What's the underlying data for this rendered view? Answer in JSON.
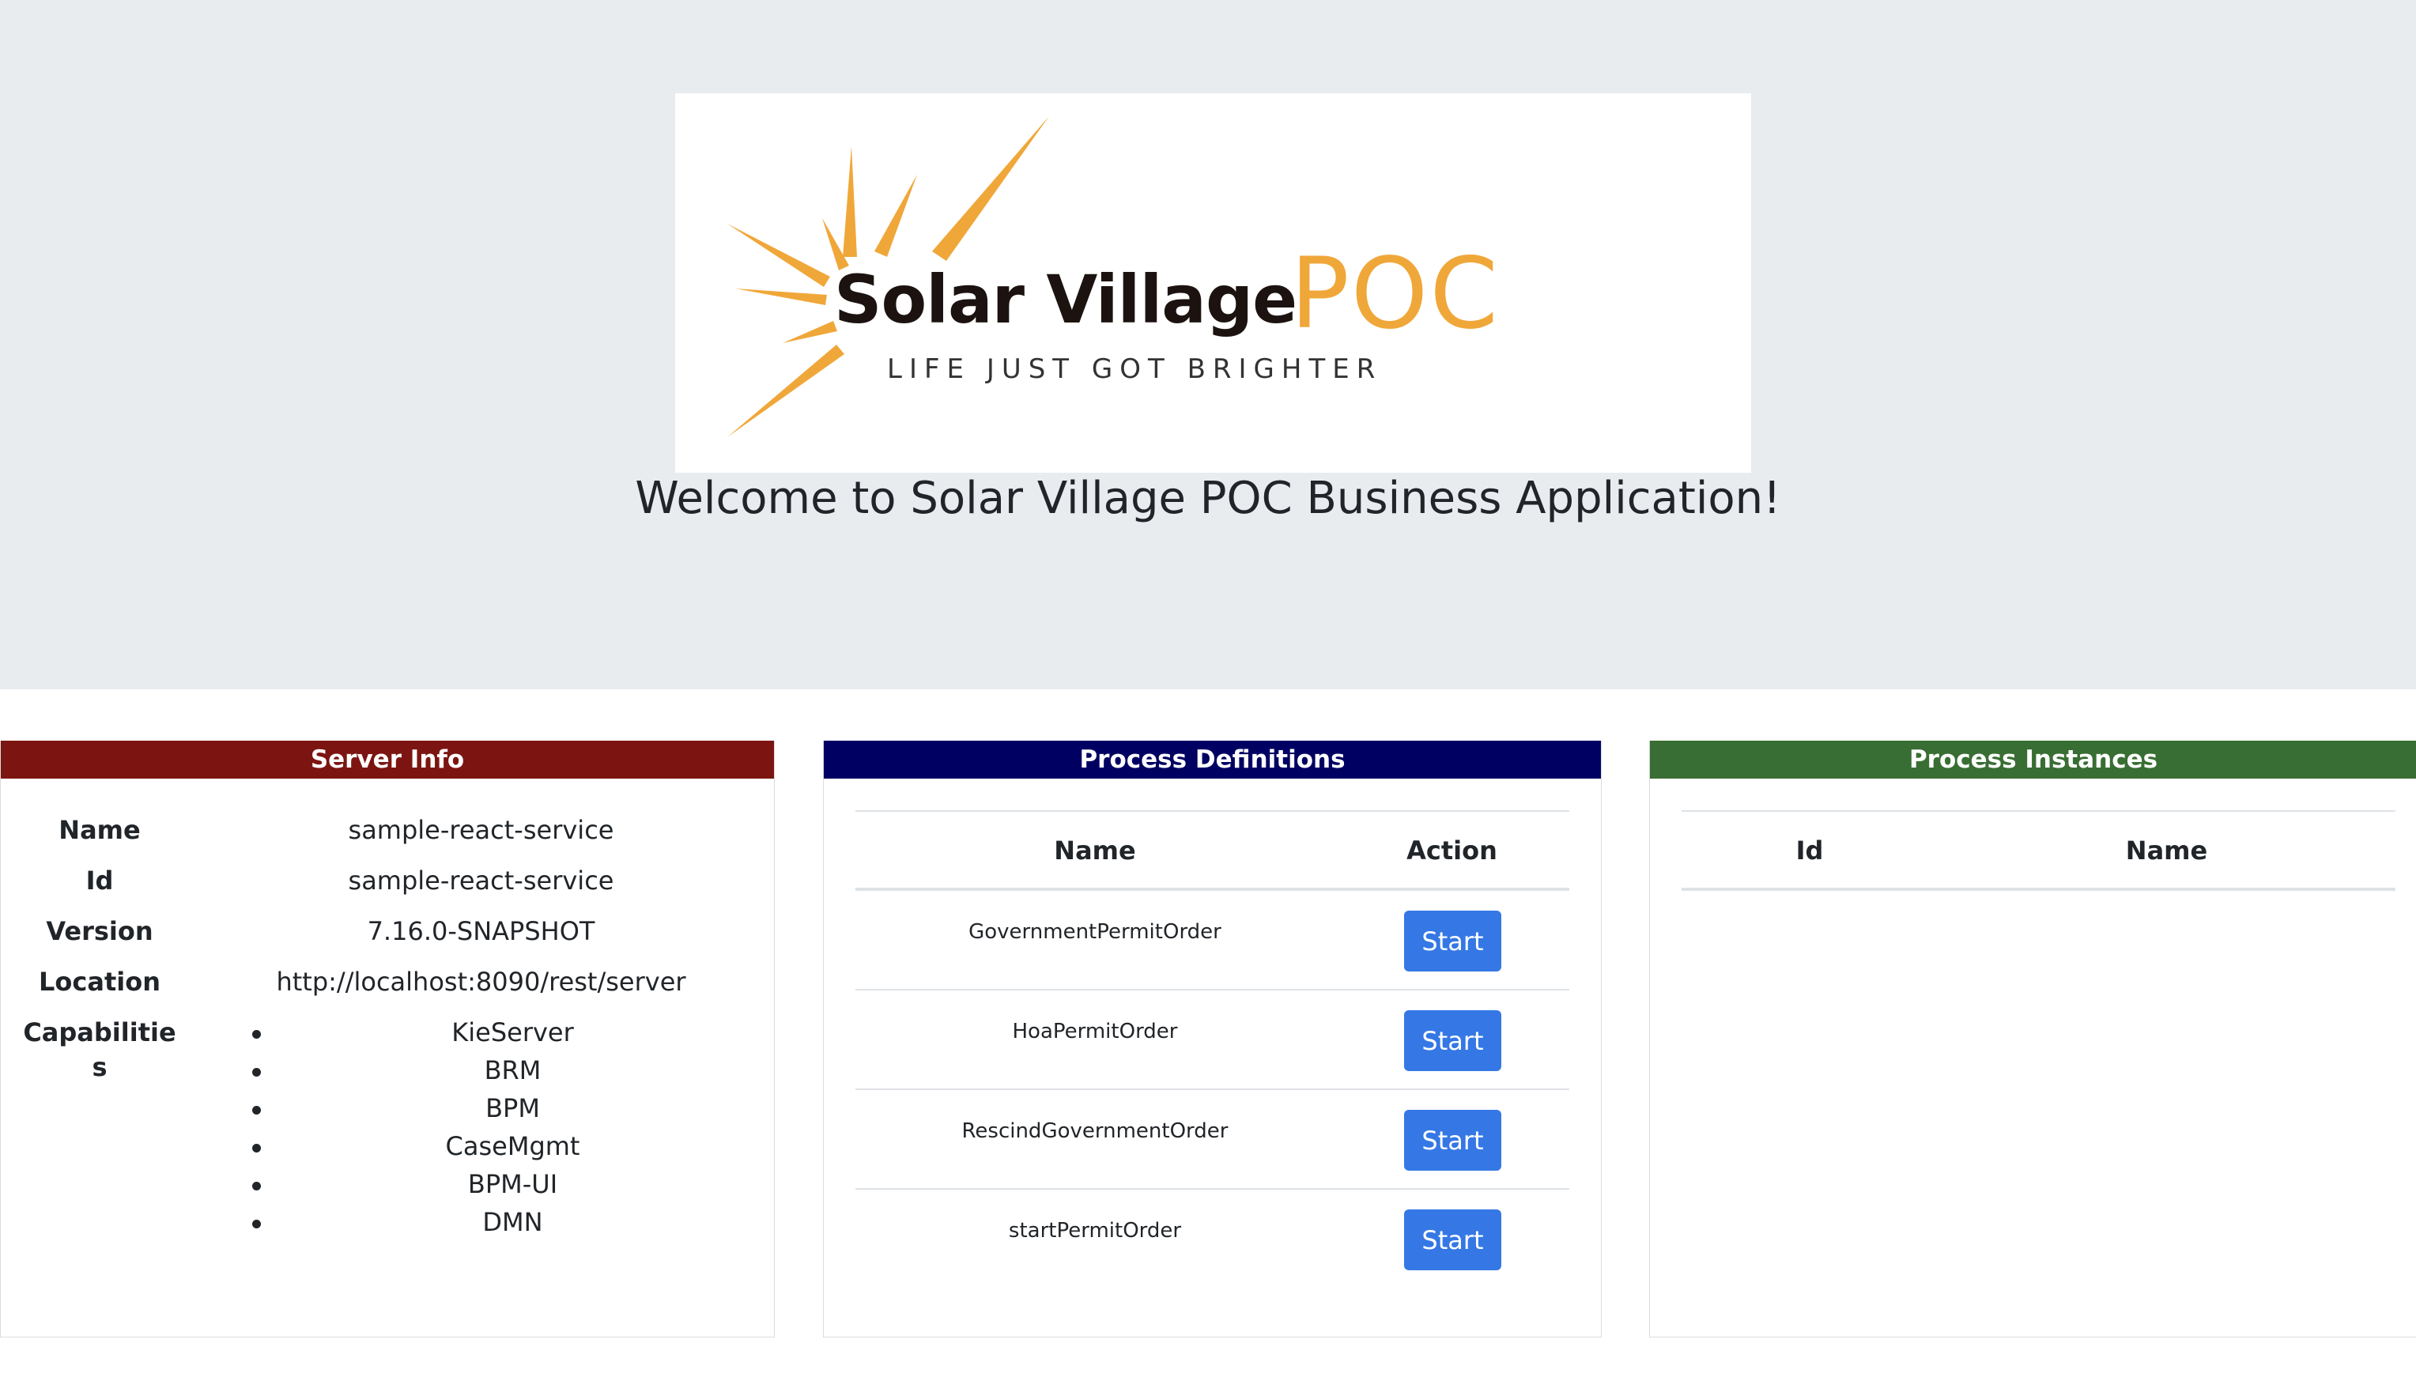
{
  "hero": {
    "logo": {
      "brand": "Solar Village",
      "suffix": "POC",
      "tagline": "LIFE JUST GOT BRIGHTER"
    },
    "welcome": "Welcome to Solar Village POC Business Application!",
    "background_color": "#e9ecef"
  },
  "server_info": {
    "title": "Server Info",
    "header_color": "#7c1511",
    "labels": {
      "name": "Name",
      "id": "Id",
      "version": "Version",
      "location": "Location",
      "capabilities_1": "Capabilitie",
      "capabilities_2": "s"
    },
    "values": {
      "name": "sample-react-service",
      "id": "sample-react-service",
      "version": "7.16.0-SNAPSHOT",
      "location": "http://localhost:8090/rest/server"
    },
    "capabilities": [
      "KieServer",
      "BRM",
      "BPM",
      "CaseMgmt",
      "BPM-UI",
      "DMN"
    ]
  },
  "process_definitions": {
    "title": "Process Definitions",
    "header_color": "#000062",
    "columns": {
      "name": "Name",
      "action": "Action"
    },
    "rows": [
      {
        "name": "GovernmentPermitOrder",
        "action_label": "Start"
      },
      {
        "name": "HoaPermitOrder",
        "action_label": "Start"
      },
      {
        "name": "RescindGovernmentOrder",
        "action_label": "Start"
      },
      {
        "name": "startPermitOrder",
        "action_label": "Start"
      }
    ],
    "button_color": "#3578e5"
  },
  "process_instances": {
    "title": "Process Instances",
    "header_color": "#386e33",
    "columns": {
      "id": "Id",
      "name": "Name"
    },
    "rows": []
  }
}
